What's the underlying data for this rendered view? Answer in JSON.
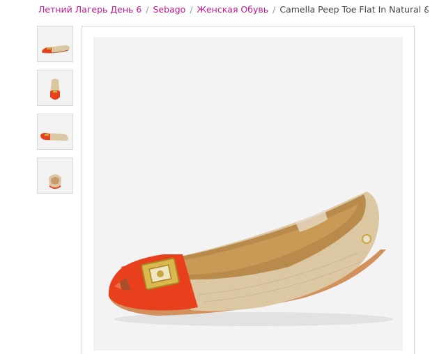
{
  "breadcrumb": {
    "items": [
      {
        "label": "Летний Лагерь День 6"
      },
      {
        "label": "Sebago"
      },
      {
        "label": "Женская Обувь"
      }
    ],
    "separator": "/",
    "current": "Camella Peep Toe Flat In Natural & Orange"
  },
  "thumbnails": [
    {
      "view": "side"
    },
    {
      "view": "front"
    },
    {
      "view": "side-reverse"
    },
    {
      "view": "back"
    }
  ],
  "colors": {
    "link": "#c2168f",
    "patent_orange": "#e8401c",
    "natural_canvas": "#dcc7a3",
    "gold": "#c9a640"
  }
}
